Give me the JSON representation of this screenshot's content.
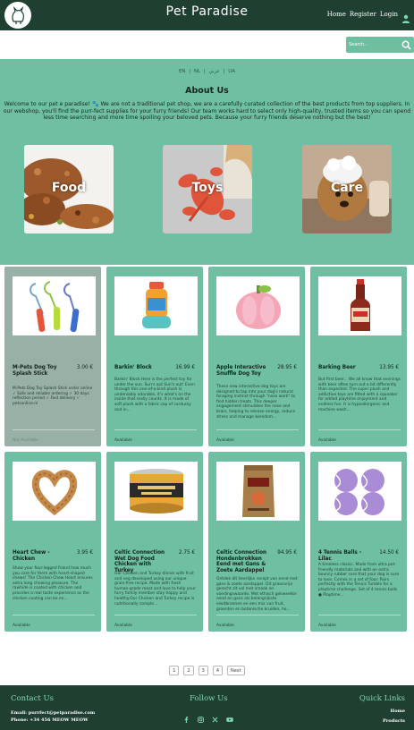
{
  "header": {
    "title": "Pet Paradise",
    "nav": {
      "home": "Home",
      "register": "Register",
      "login": "Login"
    }
  },
  "search": {
    "placeholder": "Search.."
  },
  "about": {
    "languages": [
      "EN",
      "NL",
      "عربي",
      "UA"
    ],
    "separator": "|",
    "title": "About Us",
    "text": "Welcome to our pet e paradise! 🐾 We are not a traditional pet shop, we are a carefully curated collection of the best products from top suppliers. In our webshop, you'll find the purr-fect supplies for your furry friends! Our team works hard to select only high-quality, trusted items so you can spend less time searching and more time spoiling your beloved pets. Because your furry friends deserve nothing but the best!"
  },
  "categories": [
    {
      "label": "Food"
    },
    {
      "label": "Toys"
    },
    {
      "label": "Care"
    }
  ],
  "products": [
    {
      "name": "M-Pets Dog Toy Splash Stick",
      "price": "3.00 €",
      "desc": "M-Pets Dog Toy Splash Stick order online ✓ Safe and reliable ordering ✓ 30 days reflection period ✓ Fast delivery ✓ petsonline.nl",
      "status": "Not Available"
    },
    {
      "name": "Barkin' Block",
      "price": "16.99 €",
      "desc": "Barkin' Block Here is the perfect toy for under the sun. Sun's out Sun's out! Even through this one-of-a-kind plush is undeniably adorable, it's what's on the inside that really counts. It is made of soft plush with a fabric cap of corduroy and in...",
      "status": "Available"
    },
    {
      "name": "Apple Interactive Snuffle Dog Toy",
      "price": "28.95 €",
      "desc": "These new interactive dog toys are designed to tap into your dog's natural foraging instinct through \"nose work\" to find hidden treats. This deeper engagement stimulates the nose and brain, helping to release energy, reduce stress and manage boredom...",
      "status": "Available"
    },
    {
      "name": "Barking Beer",
      "price": "13.95 €",
      "desc": "But first beer... We all know that evenings with beer often turn out a bit differently than expected. The super plush and addictive toys are fitted with a squeaker for added playtime enjoyment and endless fun. It is hypoallergenic and machine wash...",
      "status": "Available"
    },
    {
      "name": "Heart Chew - Chicken",
      "price": "3.95 €",
      "desc": "Show your four-legged friend how much you care for them with heart-shaped chews! The Chicken Chew Heart ensures extra long chewing pleasure. The rawhide is coated with chicken and provides a real taste experience as the chicken coating can be en...",
      "status": "Available"
    },
    {
      "name": "Celtic Connection Wet Dog Food Chicken with Turkey",
      "price": "2.75 €",
      "desc": "Our Chicken and Turkey dinner with fruit and veg developed using our unique grain-free recipe. Made with fresh human-grade meat and love to help your furry family member stay happy and healthy.Our Chicken and Turkey recipe is nutritionally comple...",
      "status": "Available"
    },
    {
      "name": "Celtic Connection Hondenbrokken Eend met Gans & Zoete Aardappel",
      "price": "94.95 €",
      "desc": "Ontdek dit heerlijke recept van eend met gans & zoete aardappel. Dit graanvrije gerecht zit vol met smaak en voedingswaarde. Met ethisch gekweekte eend en gans als belangrijkste eiwitbronnen en een mix van fruit, groenten en botanische kruiden, ho...",
      "status": "Available"
    },
    {
      "name": "4 Tennis Balls - Lilac",
      "price": "14.50 €",
      "desc": "A timeless classic. Made from ultra pet-friendly materials and with an extra bouncy rubber core that your dog is sure to love. Comes in a set of four. Pairs perfectly with the Tennis Tumble for a playtime challenge. Set of 4 tennis balls ● Playtime...",
      "status": "Available"
    }
  ],
  "pagination": {
    "pages": [
      "1",
      "2",
      "3",
      "4"
    ],
    "next": "Next"
  },
  "footer": {
    "contact_title": "Contact Us",
    "email": "Email: purrfect@petparadise.com",
    "phone": "Phone: +34 456 MEOW MEOW",
    "follow_title": "Follow Us",
    "social": [
      "facebook-icon",
      "instagram-icon",
      "x-icon",
      "youtube-icon"
    ],
    "links_title": "Quick Links",
    "links": [
      "Home",
      "Products"
    ]
  },
  "colors": {
    "dark_green": "#1f3f30",
    "mint": "#6fc0a2",
    "mint_footer_heading": "#7dd9b3",
    "dimmed_card": "#98b0a6"
  }
}
